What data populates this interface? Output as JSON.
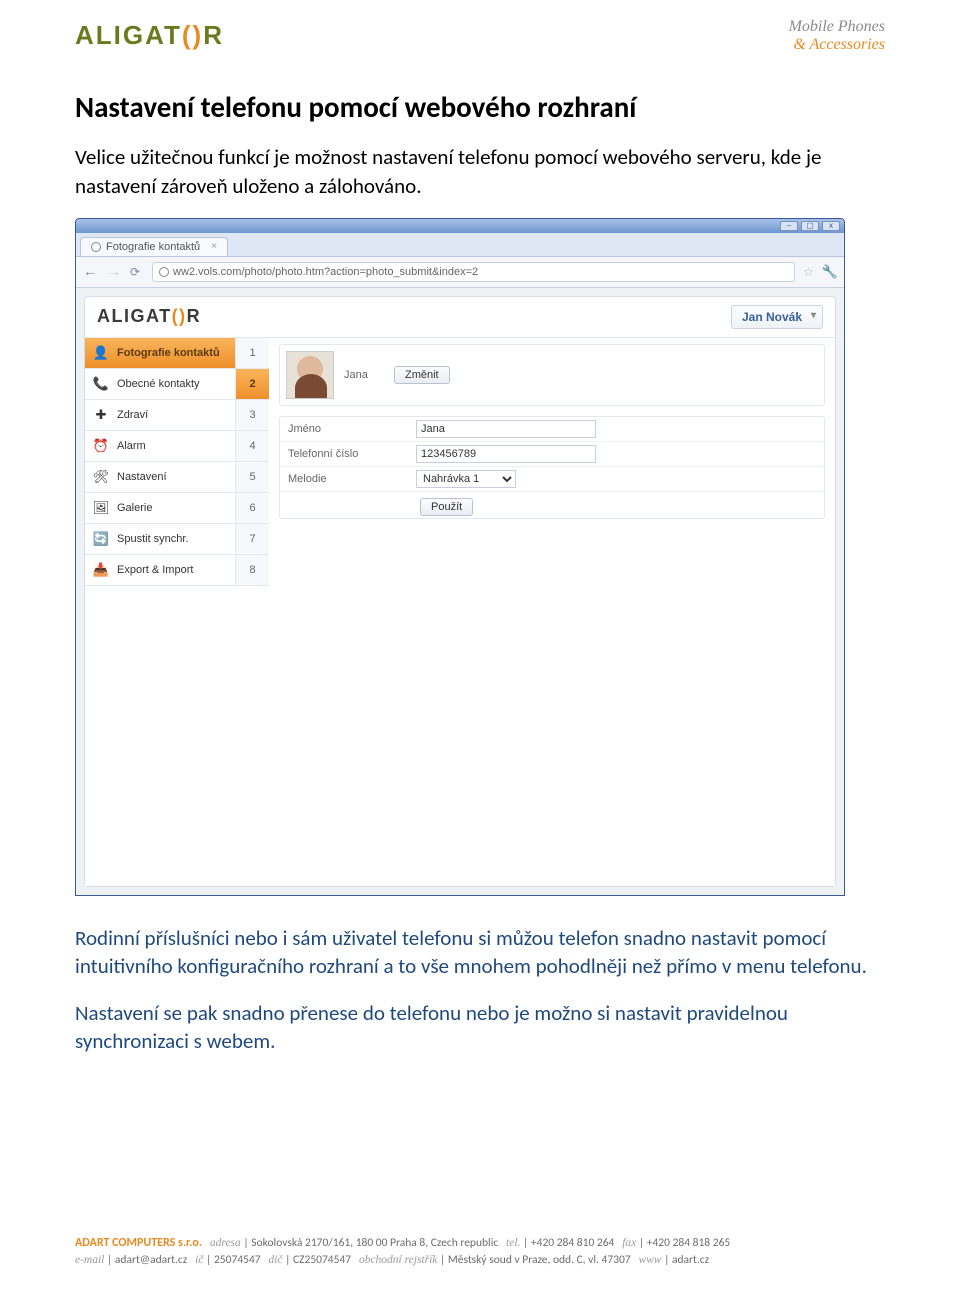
{
  "header": {
    "logo_text": "ALIGAT",
    "logo_suffix": "R",
    "tagline_line1": "Mobile Phones",
    "tagline_line2": "& Accessories"
  },
  "doc": {
    "title": "Nastavení telefonu pomocí webového rozhraní",
    "intro": "Velice užitečnou funkcí je možnost nastavení telefonu pomocí webového serveru, kde je nastavení zároveň uloženo a zálohováno.",
    "para2": "Rodinní příslušníci nebo i sám uživatel telefonu si můžou telefon snadno nastavit pomocí intuitivního konfiguračního rozhraní a to vše mnohem pohodlněji než přímo v menu telefonu.",
    "para3": "Nastavení se pak snadno přenese do telefonu nebo je možno si nastavit pravidelnou synchronizaci s webem."
  },
  "browser": {
    "tab_title": "Fotografie kontaktů",
    "url": "ww2.vols.com/photo/photo.htm?action=photo_submit&index=2"
  },
  "app": {
    "logo_text": "ALIGAT",
    "logo_suffix": "R",
    "user": "Jan Novák",
    "menu": [
      {
        "label": "Fotografie kontaktů",
        "icon": "👤",
        "active": true
      },
      {
        "label": "Obecné kontakty",
        "icon": "📞",
        "active": false
      },
      {
        "label": "Zdraví",
        "icon": "✚",
        "active": false
      },
      {
        "label": "Alarm",
        "icon": "⏰",
        "active": false
      },
      {
        "label": "Nastavení",
        "icon": "🛠",
        "active": false
      },
      {
        "label": "Galerie",
        "icon": "🖼",
        "active": false
      },
      {
        "label": "Spustit synchr.",
        "icon": "🔄",
        "active": false
      },
      {
        "label": "Export & Import",
        "icon": "📥",
        "active": false
      }
    ],
    "numbers": [
      "1",
      "2",
      "3",
      "4",
      "5",
      "6",
      "7",
      "8"
    ],
    "numbers_active_index": 1,
    "photo_name": "Jana",
    "change_btn": "Změnit",
    "form": {
      "name_label": "Jméno",
      "name_value": "Jana",
      "phone_label": "Telefonní číslo",
      "phone_value": "123456789",
      "melody_label": "Melodie",
      "melody_value": "Nahrávka 1",
      "apply_btn": "Použít"
    }
  },
  "footer": {
    "company": "ADART COMPUTERS s.r.o.",
    "address_label": "adresa",
    "address": "Sokolovská 2170/161, 180 00  Praha 8, Czech republic",
    "tel_label": "tel.",
    "tel": "+420 284 810 264",
    "fax_label": "fax",
    "fax": "+420 284 818 265",
    "email_label": "e-mail",
    "email": "adart@adart.cz",
    "ic_label": "ič",
    "ic": "25074547",
    "dic_label": "dič",
    "dic": "CZ25074547",
    "reg_label": "obchodní rejstřík",
    "reg": "Městský soud v Praze, odd. C, vl. 47307",
    "www_label": "www",
    "www": "adart.cz"
  }
}
